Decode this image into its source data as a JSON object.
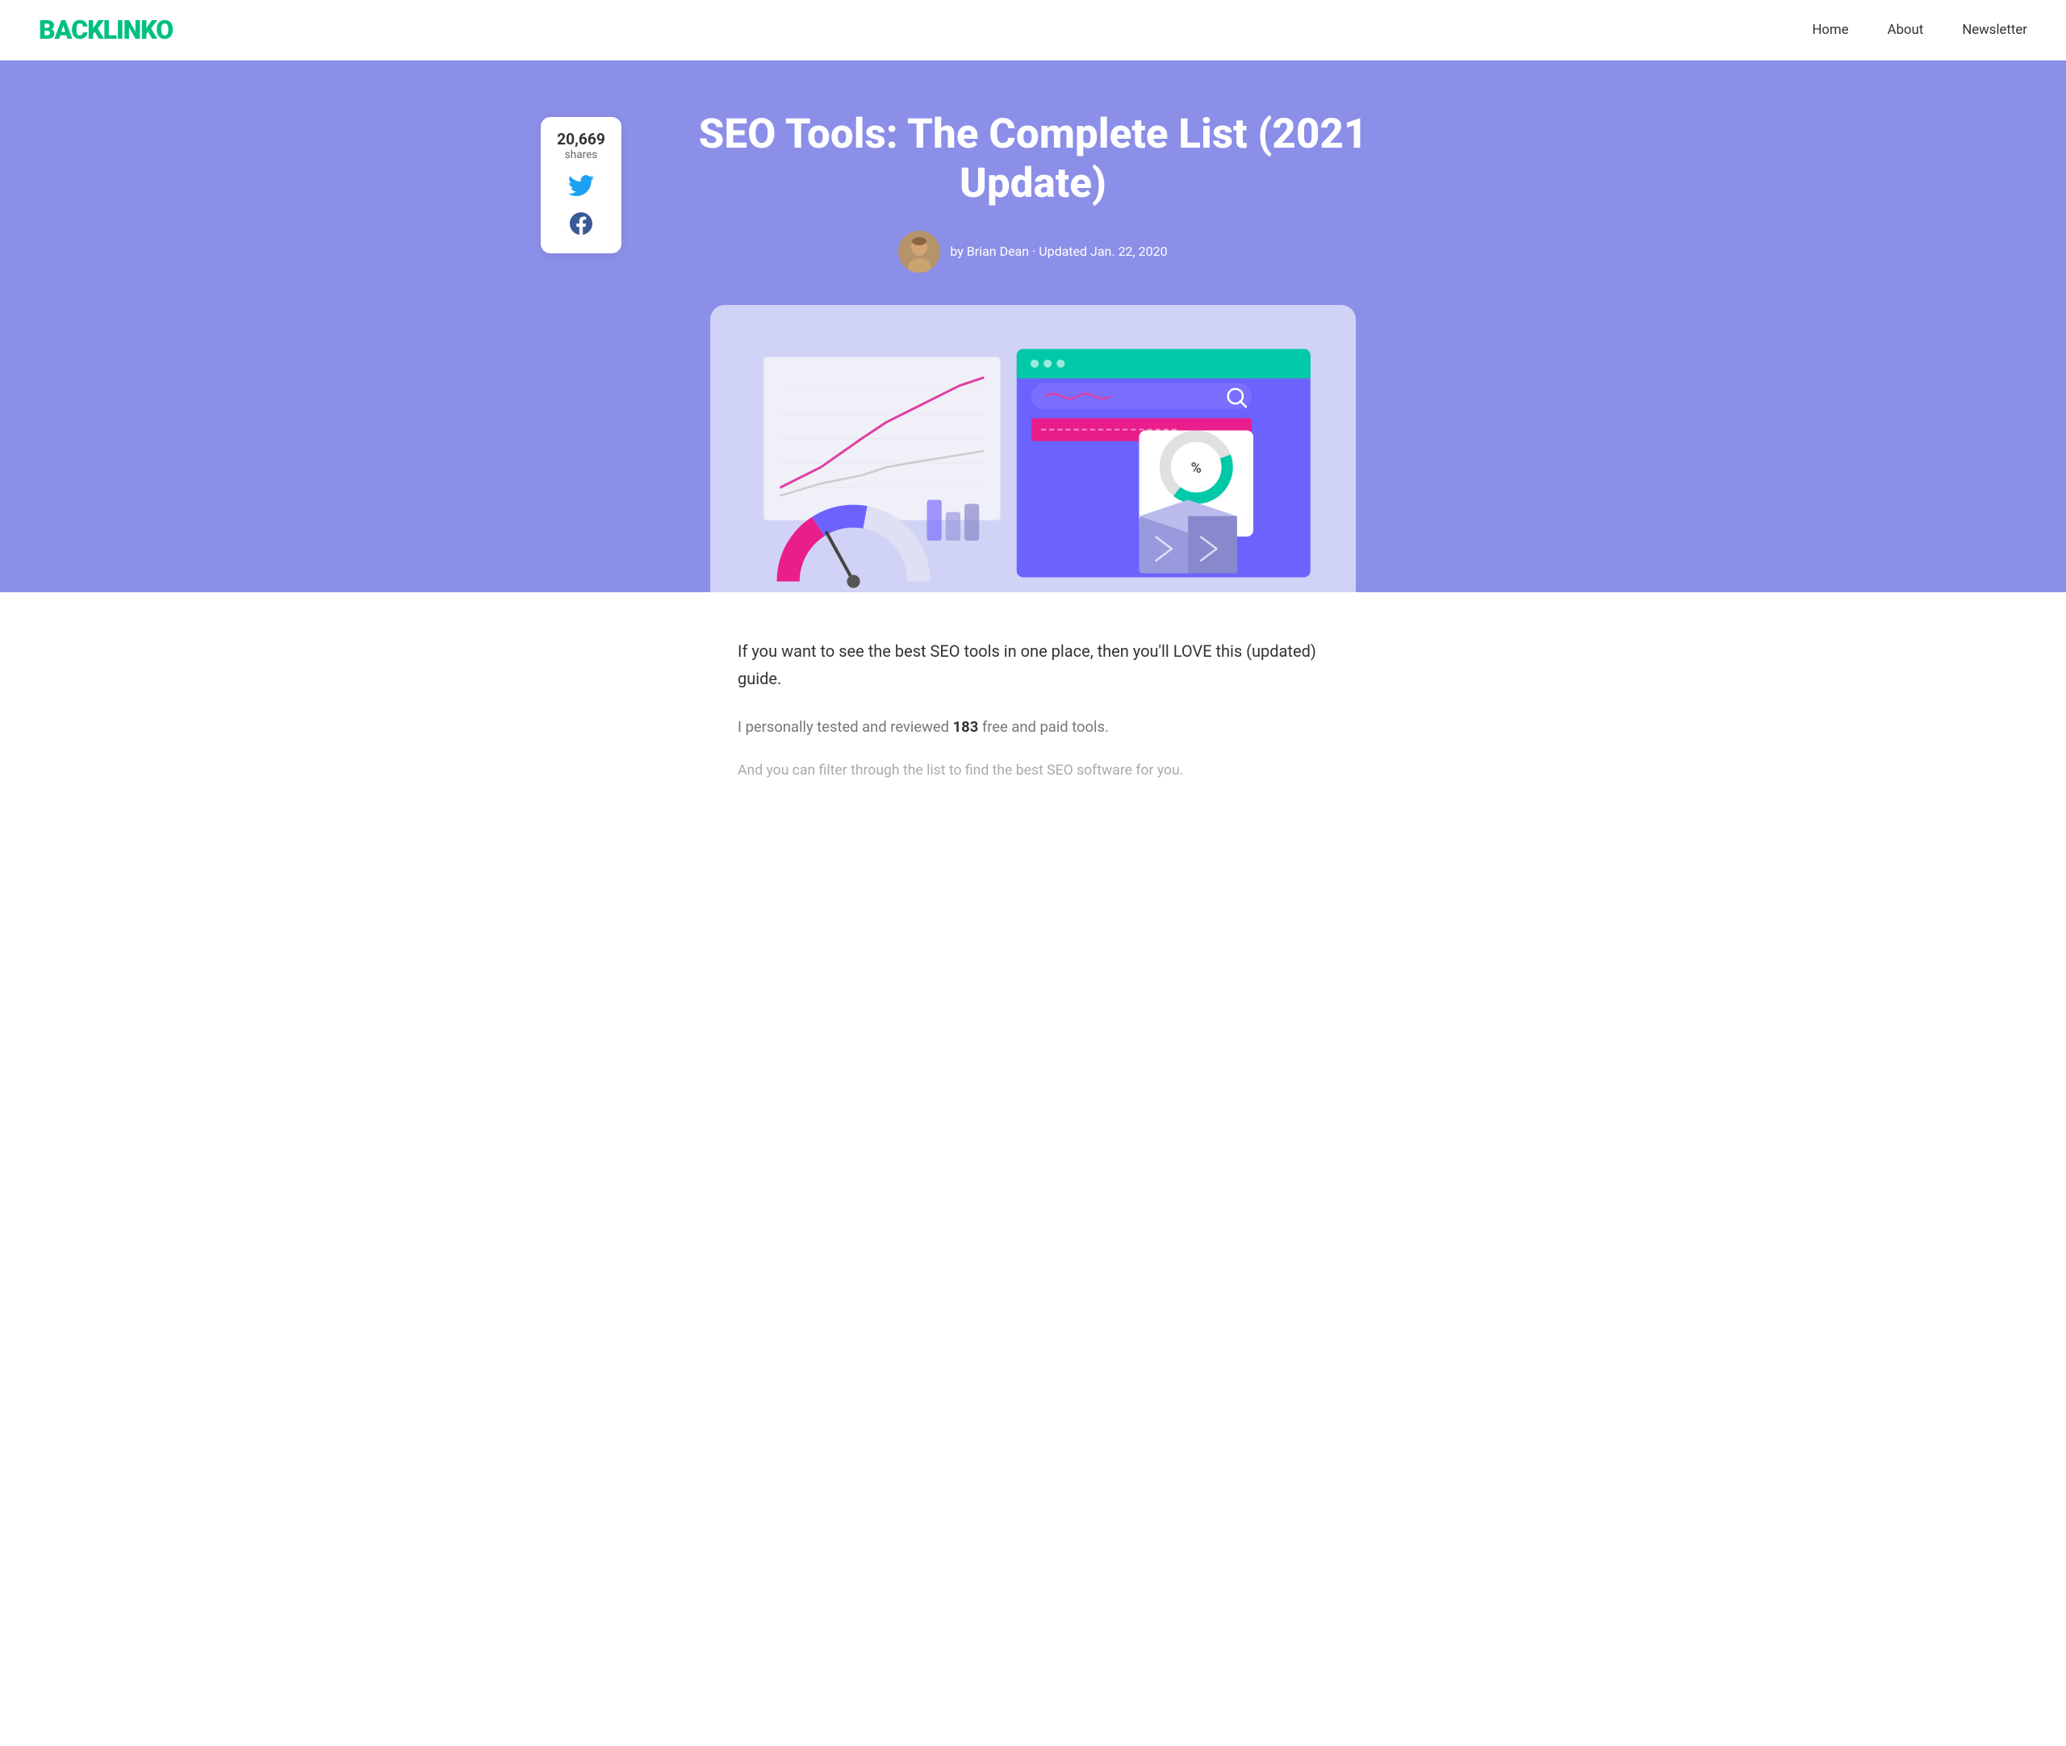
{
  "nav": {
    "logo": "BACKLINKO",
    "links": [
      {
        "label": "Home",
        "href": "#"
      },
      {
        "label": "About",
        "href": "#"
      },
      {
        "label": "Newsletter",
        "href": "#"
      }
    ]
  },
  "share": {
    "count": "20,669",
    "label": "shares"
  },
  "hero": {
    "title": "SEO Tools: The Complete List (2021 Update)",
    "author": "by Brian Dean · Updated Jan. 22, 2020"
  },
  "content": {
    "intro1": "If you want to see the best SEO tools in one place, then you'll LOVE this (updated) guide.",
    "intro2_prefix": "I personally tested and reviewed ",
    "intro2_count": "183",
    "intro2_suffix": " free and paid tools.",
    "intro3": "And you can filter through the list to find the best SEO software for you."
  },
  "colors": {
    "hero_bg": "#8b8fe8",
    "logo": "#00c07f",
    "twitter": "#1da1f2",
    "facebook": "#3b5998",
    "card_bg": "#d0d3f5"
  }
}
